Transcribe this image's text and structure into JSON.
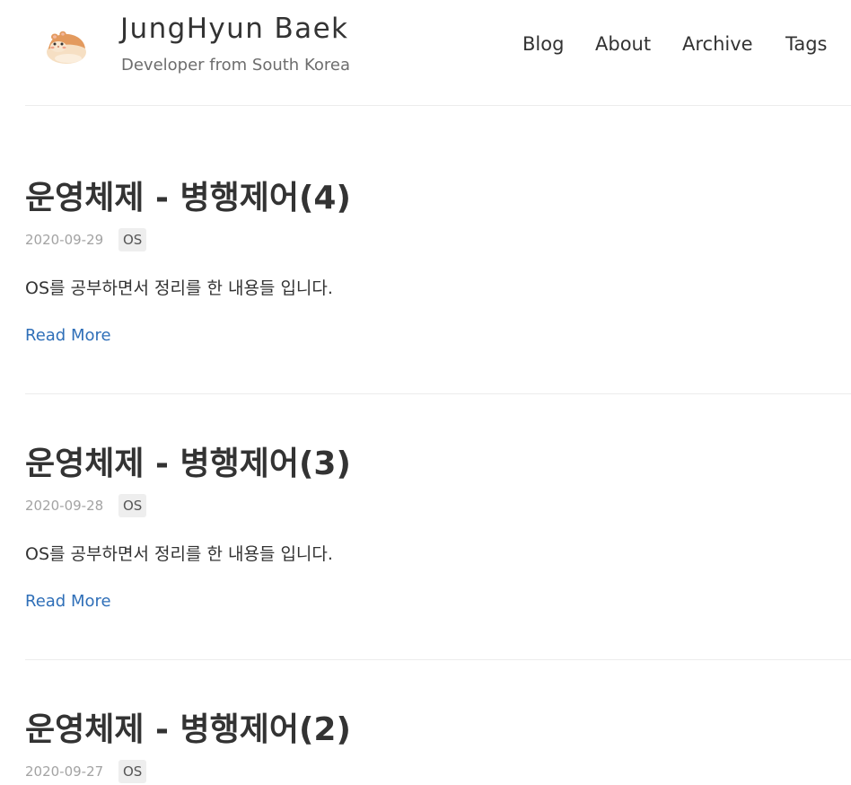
{
  "header": {
    "title": "JungHyun Baek",
    "subtitle": "Developer from South Korea",
    "avatar_icon": "hamster-avatar-icon",
    "nav": [
      "Blog",
      "About",
      "Archive",
      "Tags"
    ]
  },
  "colors": {
    "link": "#2f6fb8",
    "text": "#333333",
    "muted": "#a3a3a3",
    "tag_bg": "#eeeeee",
    "divider": "#ececec"
  },
  "posts": [
    {
      "title": "운영체제 - 병행제어(4)",
      "date": "2020-09-29",
      "tag": "OS",
      "excerpt": "OS를 공부하면서 정리를 한 내용들 입니다.",
      "read_more": "Read More"
    },
    {
      "title": "운영체제 - 병행제어(3)",
      "date": "2020-09-28",
      "tag": "OS",
      "excerpt": "OS를 공부하면서 정리를 한 내용들 입니다.",
      "read_more": "Read More"
    },
    {
      "title": "운영체제 - 병행제어(2)",
      "date": "2020-09-27",
      "tag": "OS"
    }
  ]
}
